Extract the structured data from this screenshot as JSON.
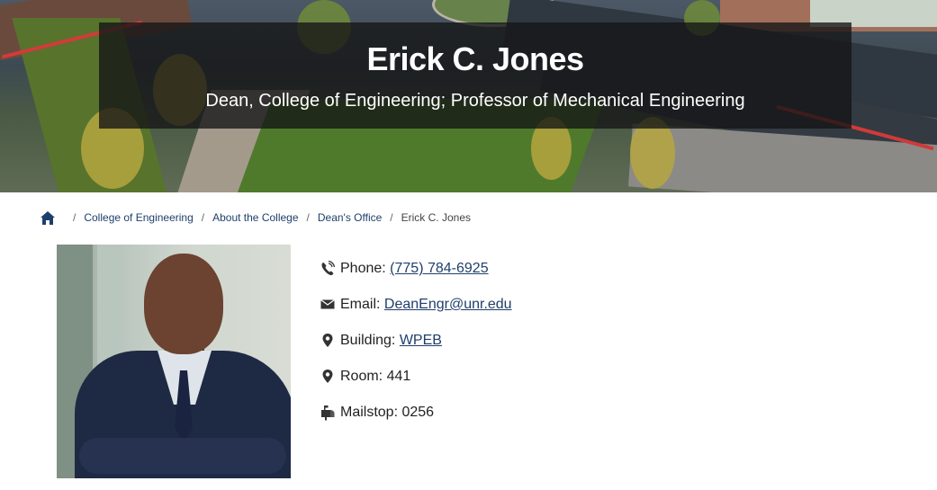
{
  "header": {
    "name": "Erick C. Jones",
    "title": "Dean, College of Engineering; Professor of Mechanical Engineering"
  },
  "breadcrumb": {
    "home_icon": "home-icon",
    "items": [
      "College of Engineering",
      "About the College",
      "Dean's Office"
    ],
    "current": "Erick C. Jones",
    "separator": "/"
  },
  "photo": {
    "alt": "Erick C. Jones portrait"
  },
  "contact": {
    "phone_label": "Phone:",
    "phone_value": "(775) 784-6925",
    "email_label": "Email:",
    "email_value": "DeanEngr@unr.edu",
    "building_label": "Building:",
    "building_value": "WPEB",
    "room_label": "Room:",
    "room_value": "441",
    "mailstop_label": "Mailstop:",
    "mailstop_value": "0256"
  },
  "colors": {
    "link": "#1f3f6b",
    "title_box_bg": "rgba(20,20,22,0.78)"
  }
}
